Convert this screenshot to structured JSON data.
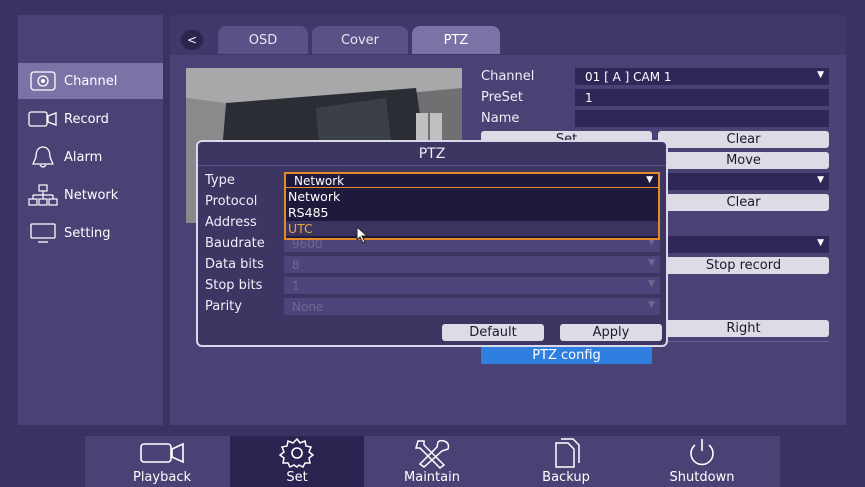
{
  "sidebar": {
    "items": [
      {
        "label": "Channel",
        "icon": "camera-icon",
        "active": true
      },
      {
        "label": "Record",
        "icon": "video-camera-icon"
      },
      {
        "label": "Alarm",
        "icon": "bell-icon"
      },
      {
        "label": "Network",
        "icon": "network-icon"
      },
      {
        "label": "Setting",
        "icon": "monitor-icon"
      }
    ]
  },
  "tabs": {
    "back": "<",
    "items": [
      "OSD",
      "Cover",
      "PTZ"
    ],
    "active": "PTZ"
  },
  "form": {
    "channel_label": "Channel",
    "channel_value": "01 [ A ] CAM 1",
    "preset_label": "PreSet",
    "preset_value": "1",
    "name_label": "Name",
    "name_value": "",
    "set_btn": "Set",
    "clear_btn": "Clear",
    "move_btn": "Move",
    "clear_btn_2": "Clear",
    "stop_record_btn": "Stop record",
    "right_btn": "Right",
    "ptz_config_btn": "PTZ config"
  },
  "dialog": {
    "title": "PTZ",
    "type_label": "Type",
    "type_value": "Network",
    "protocol_label": "Protocol",
    "address_label": "Address",
    "baudrate_label": "Baudrate",
    "baudrate_value": "9600",
    "databits_label": "Data bits",
    "databits_value": "8",
    "stopbits_label": "Stop bits",
    "stopbits_value": "1",
    "parity_label": "Parity",
    "parity_value": "None",
    "options": [
      "Network",
      "RS485",
      "UTC"
    ],
    "highlighted_option": "UTC",
    "default_btn": "Default",
    "apply_btn": "Apply"
  },
  "bottombar": {
    "items": [
      {
        "label": "Playback",
        "icon": "playback-icon"
      },
      {
        "label": "Set",
        "icon": "gear-icon",
        "active": true
      },
      {
        "label": "Maintain",
        "icon": "tools-icon"
      },
      {
        "label": "Backup",
        "icon": "backup-icon"
      },
      {
        "label": "Shutdown",
        "icon": "power-icon"
      }
    ]
  },
  "colors": {
    "background": "#3a3260",
    "panel": "#4a4274",
    "accent_blue": "#2f7fe0",
    "highlight_orange": "#e58a2a"
  }
}
